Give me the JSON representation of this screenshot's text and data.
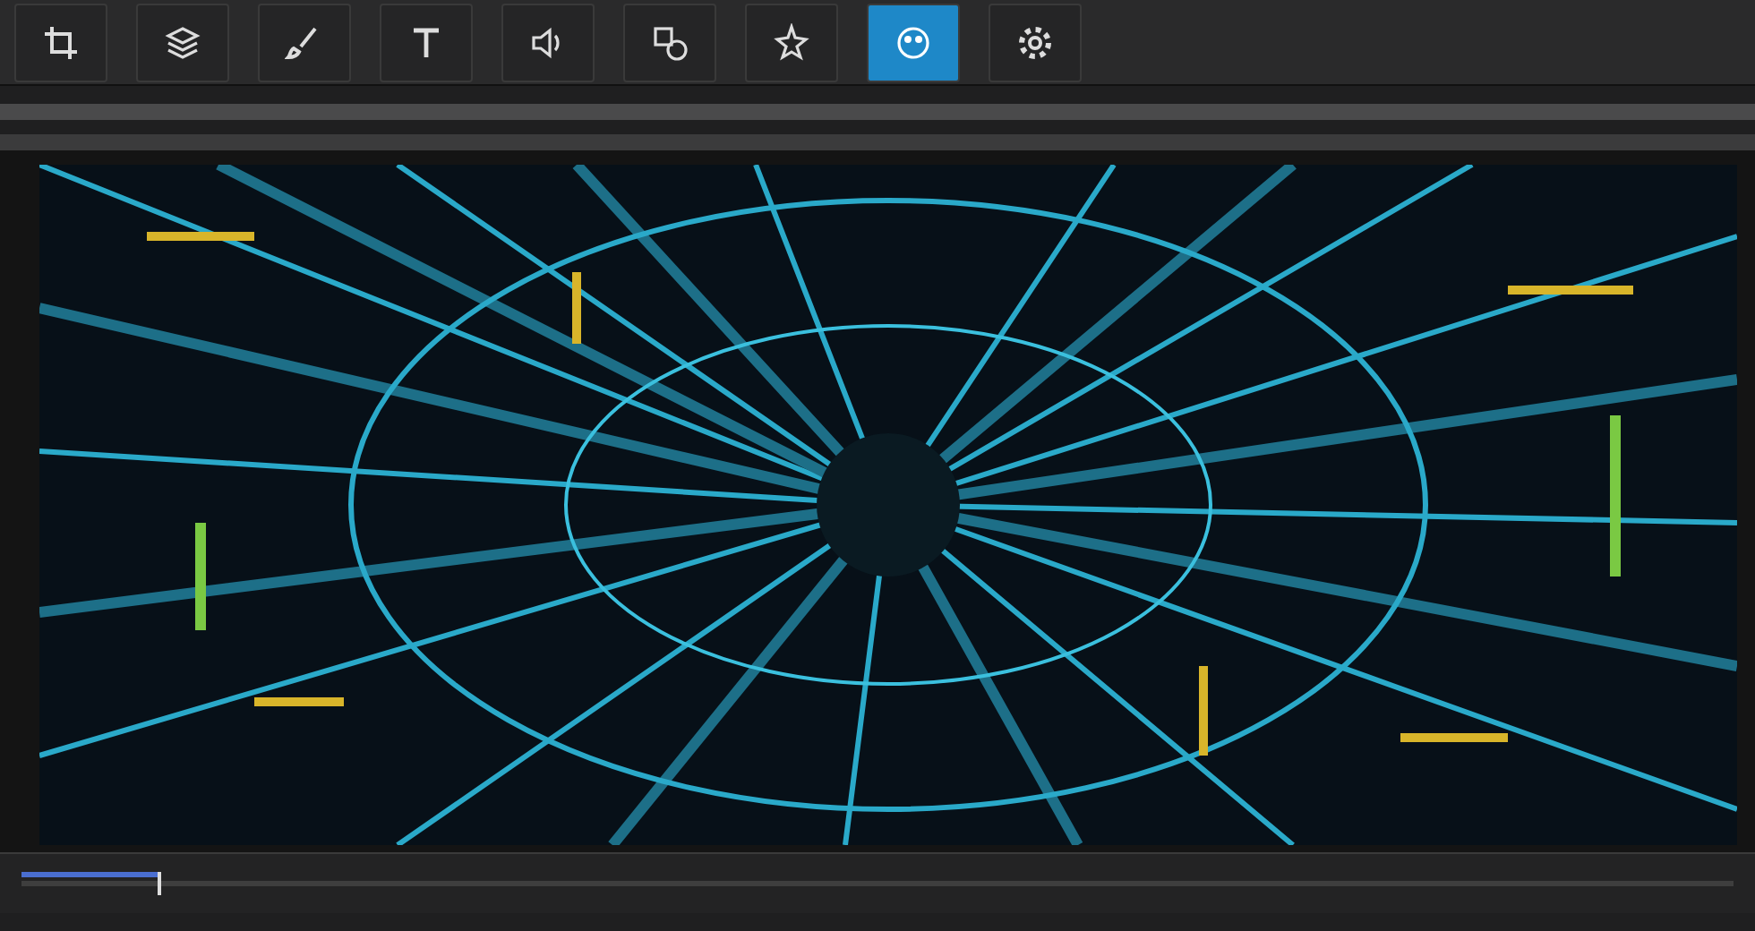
{
  "toolbar": {
    "tools": [
      {
        "kind": "crop",
        "selected": false
      },
      {
        "kind": "layers",
        "selected": false
      },
      {
        "kind": "brush",
        "selected": false
      },
      {
        "kind": "text",
        "selected": false
      },
      {
        "kind": "audio",
        "selected": false
      },
      {
        "kind": "shape",
        "selected": false
      },
      {
        "kind": "effects",
        "selected": false
      },
      {
        "kind": "color",
        "selected": true
      },
      {
        "kind": "settings",
        "selected": false
      }
    ]
  },
  "timeline": {
    "level": 0.08
  }
}
